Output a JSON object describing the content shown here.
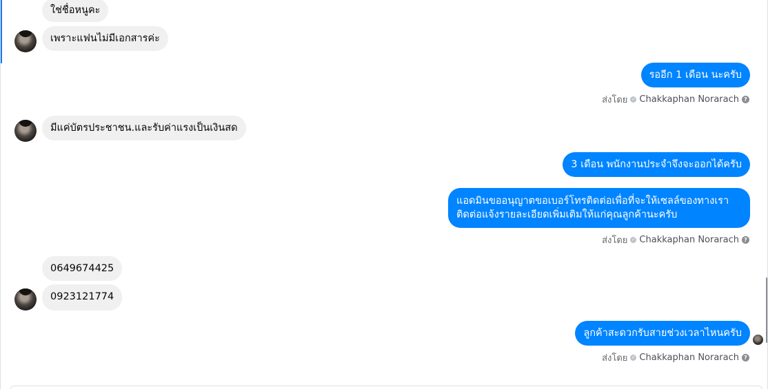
{
  "messages": [
    {
      "text": "ใช่ชื่อหนูคะ"
    },
    {
      "text": "เพราะแฟนไม่มีเอกสารค่ะ"
    },
    {
      "text": "รออีก 1 เดือน นะครับ"
    },
    {
      "text": "มีแค่บัตรประชาชน.และรับค่าแรงเป็นเงินสด"
    },
    {
      "text": "3 เดือน พนักงานประจำจึงจะออกได้ครับ"
    },
    {
      "text": "แอดมินขออนุญาตขอเบอร์โทรติดต่อเพื่อที่จะให้เซลล์ของทางเราติดต่อแจ้งรายละเอียดเพิ่มเติมให้แก่คุณลูกค้านะครับ"
    },
    {
      "text": "0649674425"
    },
    {
      "text": "0923121774"
    },
    {
      "text": "ลูกค้าสะดวกรับสายช่วงเวลาไหนครับ"
    }
  ],
  "sent_by": {
    "prefix": "ส่งโดย",
    "name": "Chakkaphan Norarach",
    "help": "?"
  },
  "colors": {
    "outgoing_bubble": "#0084ff",
    "incoming_bubble": "#f0f0f0",
    "accent": "#1877f2"
  },
  "icons": [
    "sender-avatar",
    "verified-check-icon",
    "help-icon",
    "seen-avatar"
  ]
}
